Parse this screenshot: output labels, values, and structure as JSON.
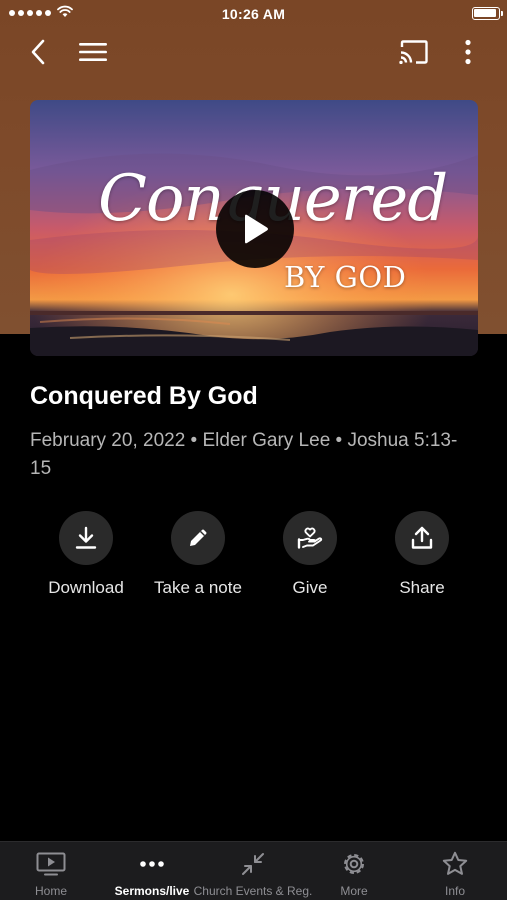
{
  "status_bar": {
    "time": "10:26 AM"
  },
  "nav": {
    "back_icon": "chevron-left-icon",
    "menu_icon": "hamburger-menu-icon",
    "cast_icon": "cast-icon",
    "more_icon": "vertical-dots-icon"
  },
  "video": {
    "script_title": "Conquered",
    "subtitle": "BY GOD",
    "play_icon": "play-icon"
  },
  "sermon": {
    "title": "Conquered By God",
    "meta": "February 20, 2022 • Elder Gary Lee • Joshua 5:13-15"
  },
  "actions": [
    {
      "label": "Download",
      "icon": "download-icon"
    },
    {
      "label": "Take a note",
      "icon": "pencil-icon"
    },
    {
      "label": "Give",
      "icon": "heart-hand-icon"
    },
    {
      "label": "Share",
      "icon": "share-icon"
    }
  ],
  "tabs": [
    {
      "label": "Home",
      "icon": "tv-play-icon",
      "active": false
    },
    {
      "label": "Sermons/live",
      "icon": "dots-icon",
      "active": true
    },
    {
      "label": "Church Events & Reg.",
      "icon": "collapse-arrows-icon",
      "active": false
    },
    {
      "label": "More",
      "icon": "gear-icon",
      "active": false
    },
    {
      "label": "Info",
      "icon": "star-icon",
      "active": false
    }
  ],
  "colors": {
    "header_brown": "#7e4a2a",
    "background": "#000000",
    "tab_bar": "#1c1c1e",
    "action_circle": "#2a2a2a",
    "meta_text": "#b6b6b6"
  }
}
